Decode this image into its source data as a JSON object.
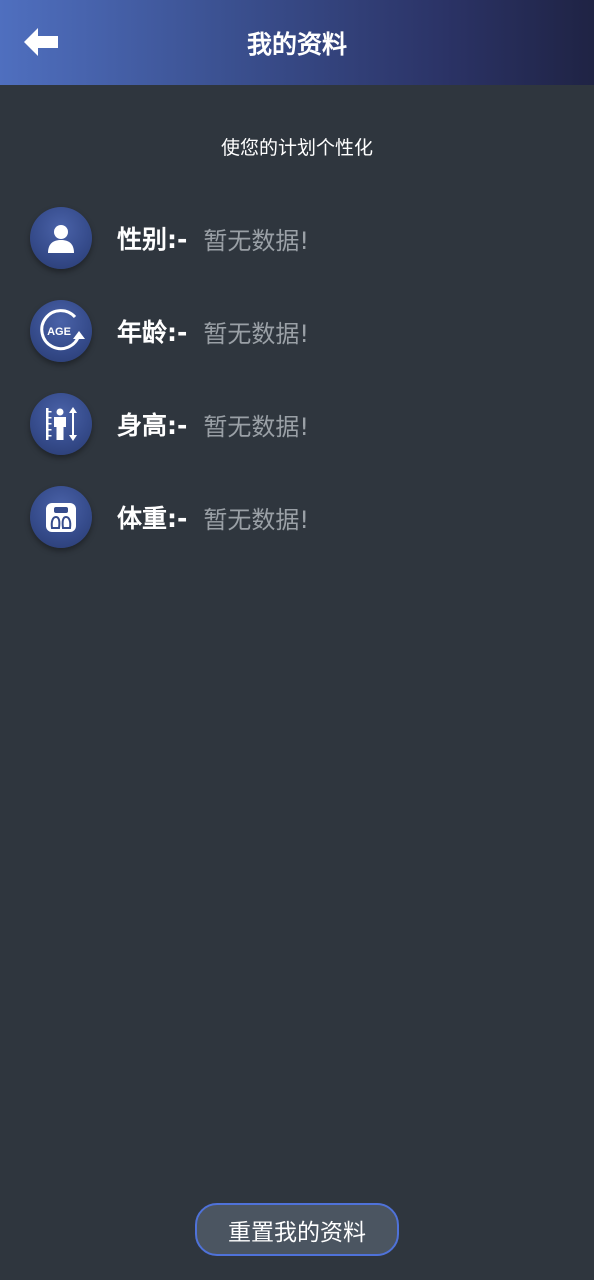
{
  "header": {
    "title": "我的资料",
    "back_icon": "arrow-left-icon"
  },
  "subtitle": "使您的计划个性化",
  "profile": {
    "rows": [
      {
        "icon": "person-icon",
        "label": "性别:-",
        "value": "暂无数据!"
      },
      {
        "icon": "age-icon",
        "label": "年龄:-",
        "value": "暂无数据!"
      },
      {
        "icon": "height-icon",
        "label": "身高:-",
        "value": "暂无数据!"
      },
      {
        "icon": "scale-icon",
        "label": "体重:-",
        "value": "暂无数据!"
      }
    ]
  },
  "footer": {
    "reset_label": "重置我的资料"
  },
  "colors": {
    "background": "#2f363e",
    "header_start": "#4f6fbf",
    "header_end": "#1f2344",
    "icon_circle": "#3a5094",
    "value_text": "#9aa0a6",
    "button_border": "#4f72d9",
    "button_fill": "#4b5561"
  }
}
